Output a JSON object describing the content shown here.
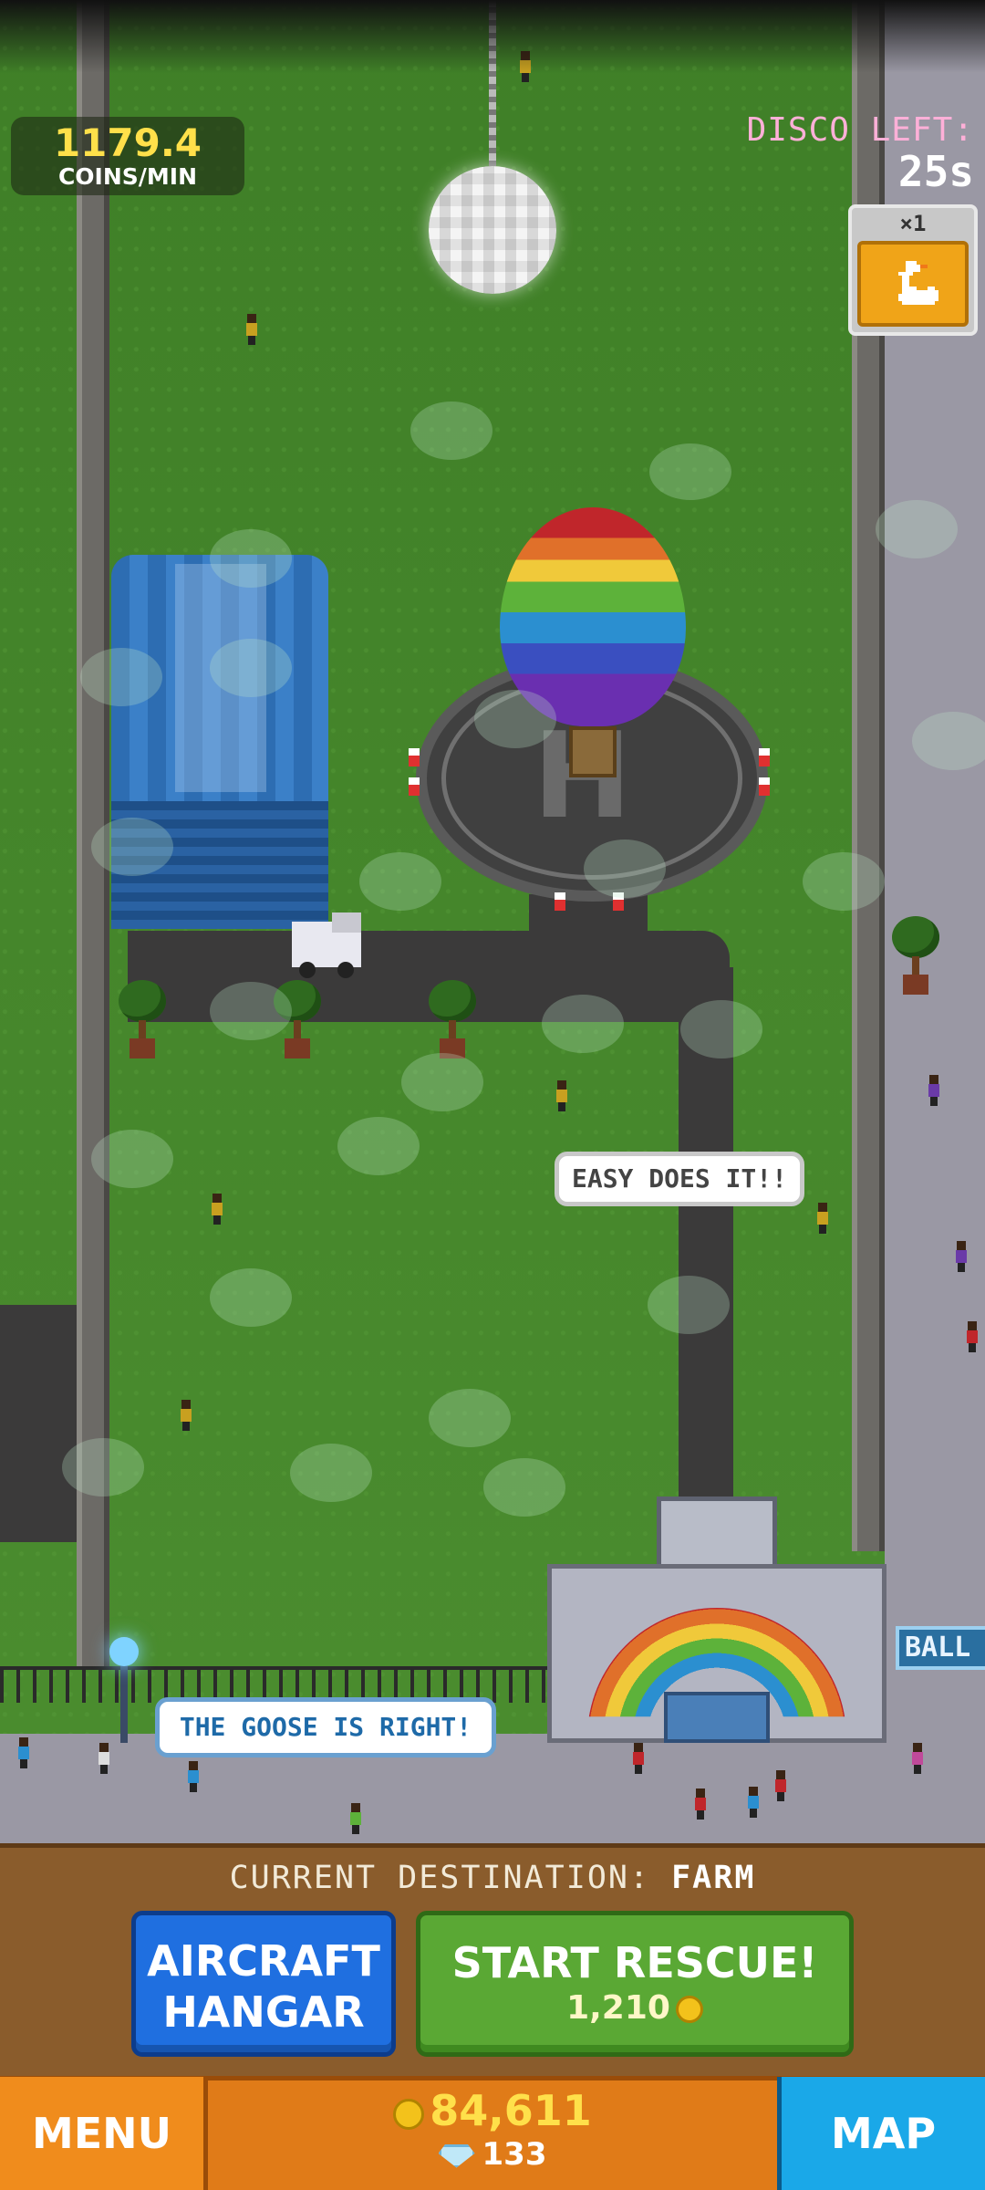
{
  "hud": {
    "coins_rate_value": "1179.4",
    "coins_rate_label": "COINS/MIN",
    "disco_label": "DISCO LEFT:",
    "disco_time": "25s",
    "goose_multiplier": "×1"
  },
  "speech": {
    "easy": "EASY DOES IT!!",
    "goose": "THE GOOSE IS RIGHT!"
  },
  "sign": {
    "ball": "BALL"
  },
  "panel": {
    "destination_label": "CURRENT DESTINATION:",
    "destination_name": "FARM",
    "hangar_line1": "AIRCRAFT",
    "hangar_line2": "HANGAR",
    "rescue_label": "START RESCUE!",
    "rescue_cost": "1,210"
  },
  "bottom": {
    "menu_label": "MENU",
    "map_label": "MAP",
    "coins": "84,611",
    "gems": "133"
  },
  "icons": {
    "goose": "goose-icon",
    "coin": "coin-icon",
    "gem": "gem-icon"
  },
  "colors": {
    "coins_yellow": "#ffe04a",
    "disco_pink": "#ffb0d8",
    "hangar_blue": "#1f6fe0",
    "rescue_green": "#5aa834",
    "menu_orange": "#f08c1c",
    "map_blue": "#1aa8e8"
  }
}
